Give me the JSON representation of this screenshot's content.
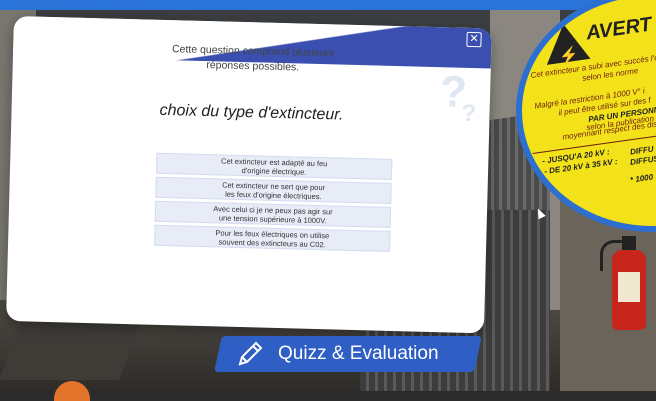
{
  "quiz": {
    "instruction_line1": "Cette question comprend plusieurs",
    "instruction_line2": "réponses possibles.",
    "question": "choix du type d'extincteur.",
    "close_icon": "close-icon",
    "options": [
      {
        "line1": "Cet extincteur est adapté au feu",
        "line2": "d'origine électrique."
      },
      {
        "line1": "Cet extincteur ne sert que pour",
        "line2": "les feux d'origine électriques."
      },
      {
        "line1": "Avec celui ci je ne peux pas agir sur",
        "line2": "une tension supérieure à 1000V."
      },
      {
        "line1": "Pour les feux électriques on utilise",
        "line2": "souvent des extincteurs au C02."
      }
    ]
  },
  "banner": {
    "label": "Quizz & Evaluation",
    "icon": "pencil-icon"
  },
  "warning_sign": {
    "title": "AVERT",
    "line1": "Cet extincteur a subi avec succès l'e",
    "line2": "selon les norme",
    "line3": "Malgré la restriction à 1000 V° i",
    "line4": "il peut être utilisé sur des f",
    "line5": "PAR UN PERSONN",
    "line6": "selon la publication U",
    "line7": "moyennant respect des dis",
    "row1_left": "- JUSQU'A 20 kV :",
    "row1_right": "DIFFU",
    "row2_left": "- DE 20 kV à 35 kV :",
    "row2_right": "DIFFUS",
    "footer": "* 1000"
  },
  "colors": {
    "accent": "#2f5fc4",
    "top_bar": "#2a73d8",
    "option_bg": "#e7ecf7",
    "warning_yellow": "#f3e21a"
  }
}
